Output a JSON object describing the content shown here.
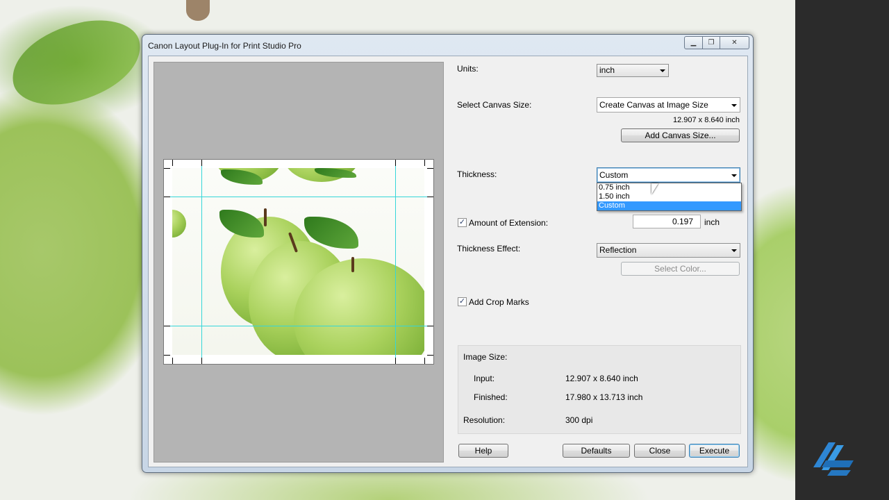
{
  "window": {
    "title": "Canon Layout Plug-In for Print Studio Pro"
  },
  "form": {
    "units_label": "Units:",
    "units_value": "inch",
    "canvas_label": "Select Canvas Size:",
    "canvas_value": "Create Canvas at Image Size",
    "canvas_dims": "12.907 x 8.640 inch",
    "add_canvas_button": "Add Canvas Size...",
    "thickness_label": "Thickness:",
    "thickness_value": "Custom",
    "thickness_options": [
      "0.75 inch",
      "1.50 inch",
      "Custom"
    ],
    "extension_label": "Amount of Extension:",
    "extension_checked": true,
    "extension_value": "0.197",
    "extension_unit": "inch",
    "effect_label": "Thickness Effect:",
    "effect_value": "Reflection",
    "select_color_button": "Select Color...",
    "crop_marks_label": "Add Crop Marks",
    "crop_marks_checked": true
  },
  "image_size": {
    "heading": "Image Size:",
    "input_label": "Input:",
    "input_value": "12.907 x 8.640 inch",
    "finished_label": "Finished:",
    "finished_value": "17.980 x 13.713 inch",
    "resolution_label": "Resolution:",
    "resolution_value": "300 dpi"
  },
  "buttons": {
    "help": "Help",
    "defaults": "Defaults",
    "close": "Close",
    "execute": "Execute"
  },
  "colors": {
    "guide": "#34d6d9",
    "selection": "#3399ff",
    "sidebar": "#2b2b2b"
  }
}
